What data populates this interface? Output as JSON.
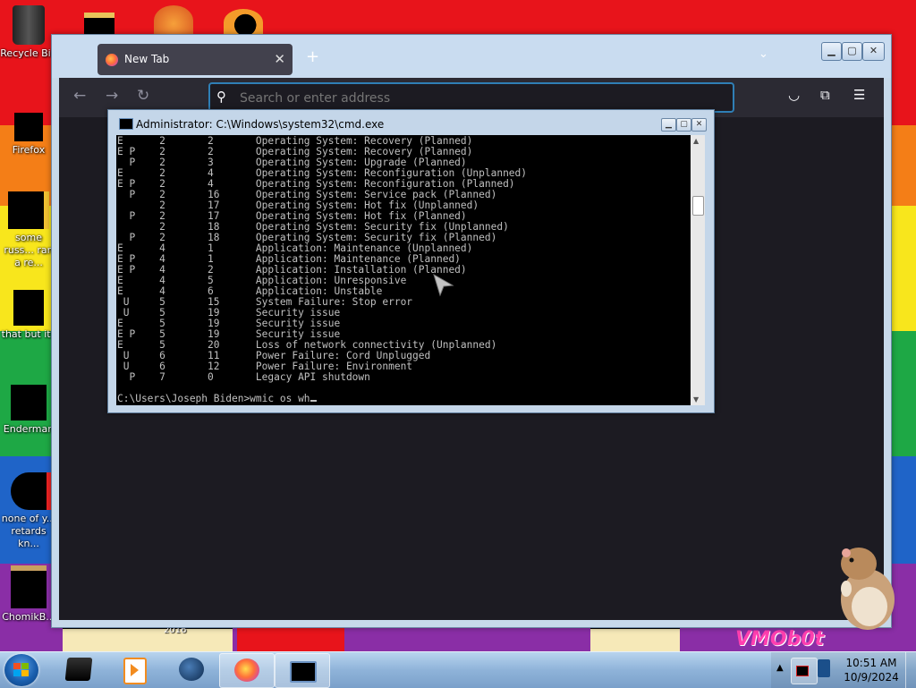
{
  "desktop": {
    "icons": [
      {
        "label": "Recycle Bin"
      },
      {
        "label": "Firefox"
      },
      {
        "label": "some russ... ran a re..."
      },
      {
        "label": "that but its"
      },
      {
        "label": "Enderman"
      },
      {
        "label": "none of y... retards kn..."
      },
      {
        "label": "ChomikB..."
      }
    ],
    "wallpaper_text": "VMOb0t",
    "year_text": "2016"
  },
  "browser": {
    "tab_title": "New Tab",
    "search_placeholder": "Search or enter address",
    "accent_color": "#2f7fb6"
  },
  "cmd": {
    "title": "Administrator: C:\\Windows\\system32\\cmd.exe",
    "lines": [
      "E      2       2       Operating System: Recovery (Planned)",
      "E P    2       2       Operating System: Recovery (Planned)",
      "  P    2       3       Operating System: Upgrade (Planned)",
      "E      2       4       Operating System: Reconfiguration (Unplanned)",
      "E P    2       4       Operating System: Reconfiguration (Planned)",
      "  P    2       16      Operating System: Service pack (Planned)",
      "       2       17      Operating System: Hot fix (Unplanned)",
      "  P    2       17      Operating System: Hot fix (Planned)",
      "       2       18      Operating System: Security fix (Unplanned)",
      "  P    2       18      Operating System: Security fix (Planned)",
      "E      4       1       Application: Maintenance (Unplanned)",
      "E P    4       1       Application: Maintenance (Planned)",
      "E P    4       2       Application: Installation (Planned)",
      "E      4       5       Application: Unresponsive",
      "E      4       6       Application: Unstable",
      " U     5       15      System Failure: Stop error",
      " U     5       19      Security issue",
      "E      5       19      Security issue",
      "E P    5       19      Security issue",
      "E      5       20      Loss of network connectivity (Unplanned)",
      " U     6       11      Power Failure: Cord Unplugged",
      " U     6       12      Power Failure: Environment",
      "  P    7       0       Legacy API shutdown",
      ""
    ],
    "prompt": "C:\\Users\\Joseph Biden>wmic os wh"
  },
  "taskbar": {
    "items": [
      "explorer",
      "media-player",
      "app",
      "firefox",
      "cmd"
    ],
    "time": "10:51 AM",
    "date": "10/9/2024"
  }
}
